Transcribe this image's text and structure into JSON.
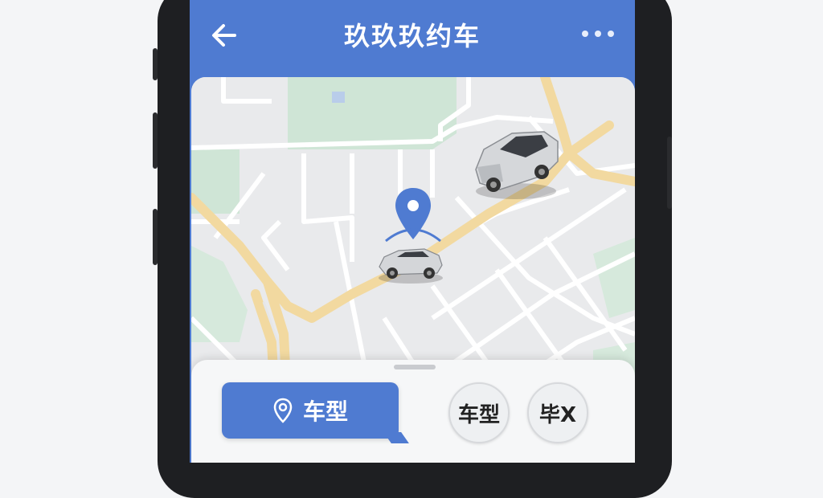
{
  "app": {
    "title": "玖玖玖约车",
    "back_icon": "arrow-left-icon",
    "more_icon": "more-horizontal-icon"
  },
  "map": {
    "pin_icon": "location-pin-icon",
    "cars": [
      "silver-sedan",
      "silver-sedan"
    ]
  },
  "bottom_sheet": {
    "primary_button": {
      "label": "车型",
      "icon": "location-pin-icon"
    },
    "option_buttons": [
      {
        "label": "车型"
      },
      {
        "label": "毕X"
      }
    ]
  },
  "colors": {
    "brand": "#4f7bd1",
    "road": "#f2d9a0",
    "park": "#cfe5d6"
  }
}
